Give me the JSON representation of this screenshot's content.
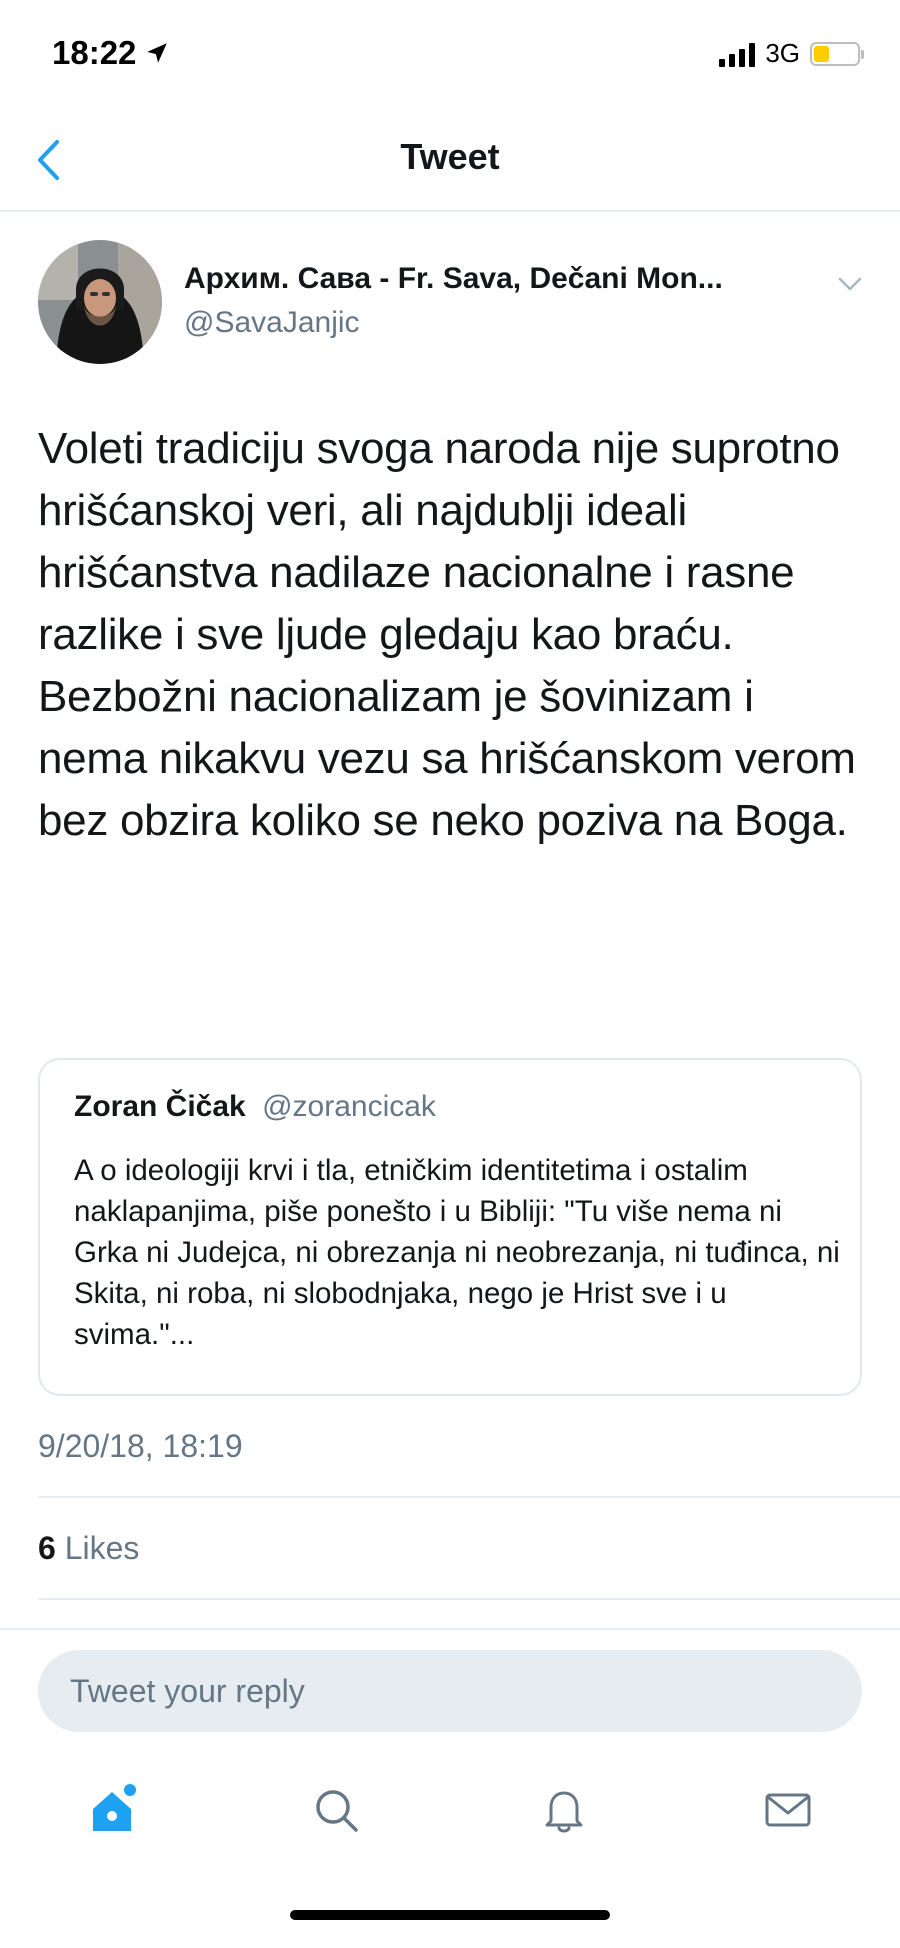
{
  "status_bar": {
    "time": "18:22",
    "network": "3G",
    "battery_level": 0.35,
    "battery_color": "#ffcc00"
  },
  "nav": {
    "title": "Tweet"
  },
  "tweet": {
    "author_name": "Архим. Сава - Fr. Sava, Dečani Mon...",
    "author_handle": "@SavaJanjic",
    "text": "Voleti tradiciju svoga naroda nije suprotno hrišćanskoj veri, ali najdublji ideali hrišćanstva nadilaze nacionalne i rasne razlike i sve ljude gledaju kao braću. Bezbožni nacionalizam je šovinizam i nema nikakvu vezu sa hrišćanskom verom bez obzira koliko se neko poziva na Boga.",
    "quoted": {
      "name": "Zoran Čičak",
      "handle": "@zorancicak",
      "text": "A o ideologiji krvi i tla, etničkim identitetima i ostalim naklapanjima, piše ponešto i u Bibliji: \"Tu više nema ni Grka ni Judejca, ni obrezanja ni neobrezanja, ni tuđinca, ni Skita, ni roba, ni slobodnjaka, nego je Hrist sve i u svima.\"..."
    },
    "timestamp": "9/20/18, 18:19",
    "likes_count": "6",
    "likes_label": "Likes"
  },
  "reply": {
    "placeholder": "Tweet your reply"
  },
  "tab_bar": {
    "items": [
      "home-icon",
      "search-icon",
      "notifications-icon",
      "messages-icon"
    ],
    "active": "home-icon",
    "accent_color": "#1da1f2",
    "inactive_color": "#657786"
  }
}
